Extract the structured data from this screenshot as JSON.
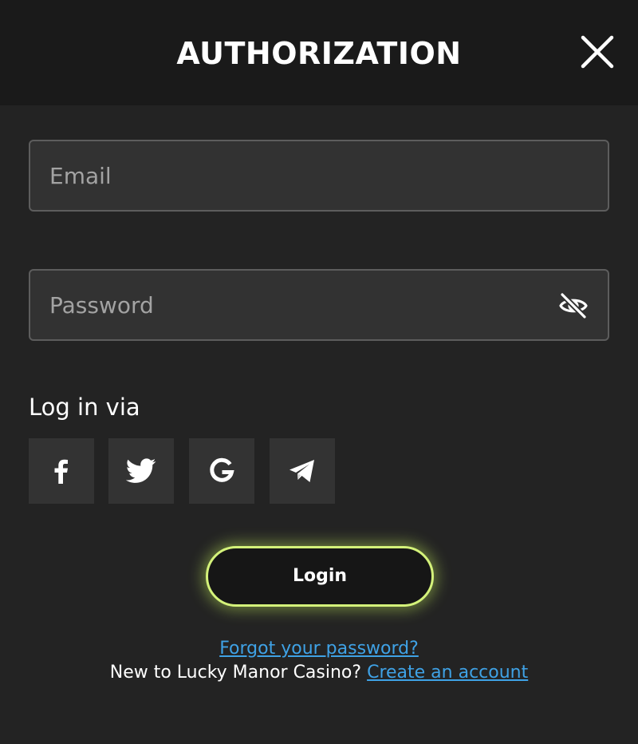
{
  "header": {
    "title": "AUTHORIZATION",
    "close_icon": "close-icon"
  },
  "form": {
    "email_placeholder": "Email",
    "email_value": "",
    "password_placeholder": "Password",
    "password_value": "",
    "password_toggle_icon": "eye-off-icon"
  },
  "social": {
    "label": "Log in via",
    "providers": [
      {
        "name": "Facebook",
        "icon": "facebook-icon"
      },
      {
        "name": "Twitter",
        "icon": "twitter-icon"
      },
      {
        "name": "Google",
        "icon": "google-icon"
      },
      {
        "name": "Telegram",
        "icon": "telegram-icon"
      }
    ]
  },
  "actions": {
    "login_label": "Login",
    "forgot_password_link": "Forgot your password?",
    "new_user_text": "New to Lucky Manor Casino?",
    "create_account_link": "Create an account"
  },
  "colors": {
    "background": "#232323",
    "header_background": "#1a1a1a",
    "field_background": "#323232",
    "field_border": "#5d5d5d",
    "social_tile": "#333333",
    "accent_glow": "#d4f27a",
    "link": "#3fa2e6"
  }
}
